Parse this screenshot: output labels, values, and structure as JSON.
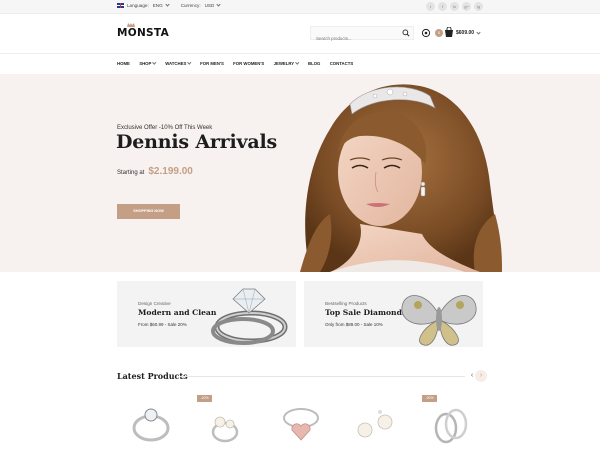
{
  "topbar": {
    "language_label": "Language:",
    "language_value": "ENG",
    "currency_label": "Currency:",
    "currency_value": "USD",
    "social": [
      "t",
      "f",
      "in",
      "g+",
      "ig"
    ]
  },
  "header": {
    "logo_text": "MONSTA",
    "search_placeholder": "Search products...",
    "cart_count": "0",
    "cart_total": "$609.00"
  },
  "nav": {
    "items": [
      {
        "label": "Home"
      },
      {
        "label": "Shop"
      },
      {
        "label": "Watches"
      },
      {
        "label": "For Men's"
      },
      {
        "label": "For Women's"
      },
      {
        "label": "Jewelry"
      },
      {
        "label": "Blog"
      },
      {
        "label": "Contacts"
      }
    ]
  },
  "hero": {
    "kicker": "Exclusive Offer -10% Off This Week",
    "title": "Dennis Arrivals",
    "price_prefix": "Starting at",
    "price": "$2.199.00",
    "button": "SHOPPING NOW"
  },
  "promos": [
    {
      "kicker": "Design Creative",
      "title": "Modern and Clean",
      "line": "From  $60.99 - Sale 20%"
    },
    {
      "kicker": "Bestselling Products",
      "title": "Top Sale Diamonds",
      "line": "Only  from  $89.00 - Sale 10%"
    }
  ],
  "latest": {
    "title": "Latest Products",
    "prev": "‹",
    "next": "›",
    "badges": [
      "-10%",
      "-20%"
    ]
  },
  "colors": {
    "accent": "#c59f85",
    "hero_bg": "#f7f1ef",
    "promo_bg": "#f3f3f3"
  }
}
